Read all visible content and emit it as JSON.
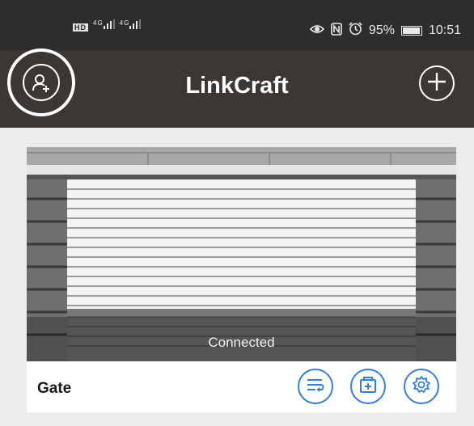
{
  "status_bar": {
    "left_indicators": [
      "HD",
      "4G",
      "4G"
    ],
    "battery": "95%",
    "time": "10:51",
    "battery_level": 0.95
  },
  "header": {
    "title": "LinkCraft",
    "profile_icon": "user-add-icon",
    "add_icon": "plus-icon"
  },
  "device_card": {
    "name": "Gate",
    "status": "Connected",
    "actions": [
      "list-icon",
      "add-device-icon",
      "gear-icon"
    ]
  },
  "colors": {
    "accent": "#2f7fe0",
    "header_bg": "#3a3735",
    "status_bg": "#2f2d2b"
  }
}
